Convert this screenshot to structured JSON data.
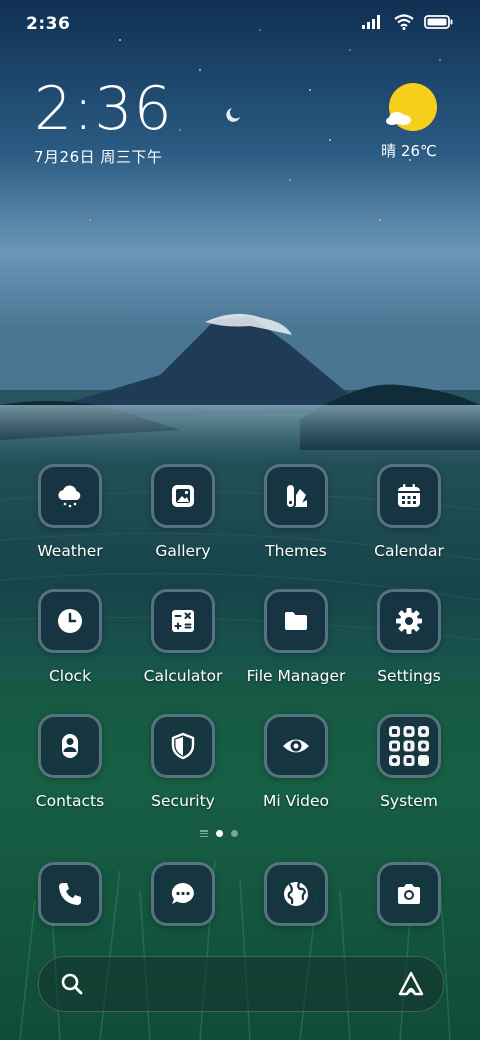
{
  "status_bar": {
    "time": "2:36",
    "icons": [
      "signal-icon",
      "wifi-icon",
      "battery-icon"
    ]
  },
  "clock_widget": {
    "time": "2:36",
    "date": "7月26日 周三下午"
  },
  "weather_widget": {
    "icon": "sun-cloud-icon",
    "text": "晴 26℃"
  },
  "apps": [
    {
      "label": "Weather",
      "icon": "cloud-rain-icon"
    },
    {
      "label": "Gallery",
      "icon": "image-icon"
    },
    {
      "label": "Themes",
      "icon": "themes-icon"
    },
    {
      "label": "Calendar",
      "icon": "calendar-icon"
    },
    {
      "label": "Clock",
      "icon": "clock-icon"
    },
    {
      "label": "Calculator",
      "icon": "calculator-icon"
    },
    {
      "label": "File Manager",
      "icon": "folder-icon"
    },
    {
      "label": "Settings",
      "icon": "gear-icon"
    },
    {
      "label": "Contacts",
      "icon": "person-icon"
    },
    {
      "label": "Security",
      "icon": "shield-icon"
    },
    {
      "label": "Mi Video",
      "icon": "eye-icon"
    },
    {
      "label": "System",
      "icon": "folder-grid-icon"
    }
  ],
  "page_indicator": {
    "pages": 2,
    "current": 1
  },
  "dock": [
    {
      "icon": "phone-icon"
    },
    {
      "icon": "message-icon"
    },
    {
      "icon": "globe-icon"
    },
    {
      "icon": "camera-icon"
    }
  ],
  "search_bar": {
    "left_icon": "search-icon",
    "right_icon": "assistant-icon"
  },
  "colors": {
    "icon_bg": "#163040",
    "icon_border": "#8ca5b4",
    "sun": "#f7cf1a"
  }
}
